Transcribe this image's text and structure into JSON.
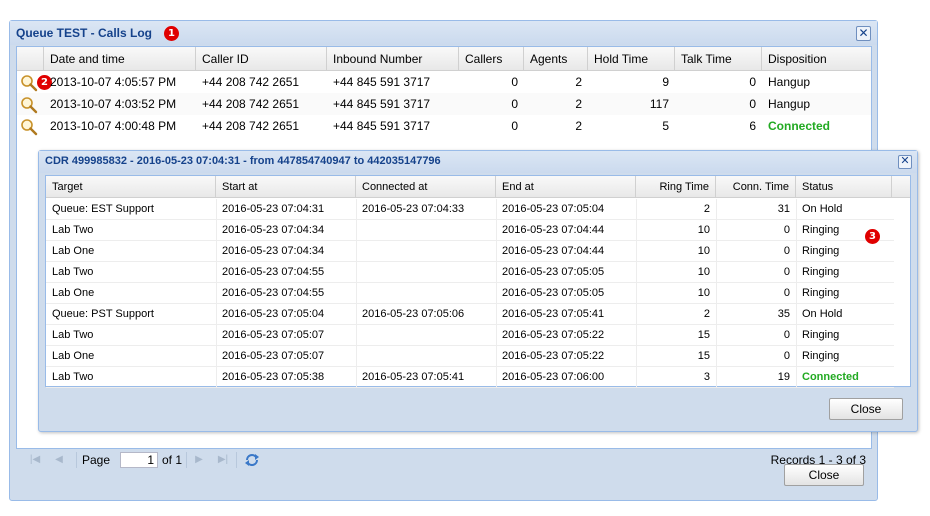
{
  "outer_window": {
    "title": "Queue TEST - Calls Log",
    "close_glyph": "✕",
    "badge": "1",
    "columns": [
      "Date and time",
      "Caller ID",
      "Inbound Number",
      "Callers",
      "Agents",
      "Hold Time",
      "Talk Time",
      "Disposition"
    ],
    "rows": [
      {
        "datetime": "2013-10-07 4:05:57 PM",
        "caller_id": "+44 208 742 2651",
        "inbound": "+44 845 591 3717",
        "callers": "0",
        "agents": "2",
        "hold": "9",
        "talk": "0",
        "disposition": "Hangup"
      },
      {
        "datetime": "2013-10-07 4:03:52 PM",
        "caller_id": "+44 208 742 2651",
        "inbound": "+44 845 591 3717",
        "callers": "0",
        "agents": "2",
        "hold": "117",
        "talk": "0",
        "disposition": "Hangup"
      },
      {
        "datetime": "2013-10-07 4:00:48 PM",
        "caller_id": "+44 208 742 2651",
        "inbound": "+44 845 591 3717",
        "callers": "0",
        "agents": "2",
        "hold": "5",
        "talk": "6",
        "disposition": "Connected"
      }
    ],
    "row_badge": "2",
    "pager": {
      "page_label": "Page",
      "page_value": "1",
      "of_label": "of 1",
      "records": "Records 1 - 3 of 3"
    },
    "close_button": "Close"
  },
  "inner_window": {
    "title": "CDR 499985832 - 2016-05-23 07:04:31 - from 447854740947 to 442035147796",
    "close_glyph": "✕",
    "badge": "3",
    "columns": [
      "Target",
      "Start at",
      "Connected at",
      "End at",
      "Ring Time",
      "Conn. Time",
      "Status"
    ],
    "rows": [
      {
        "target": "Queue: EST Support",
        "start": "2016-05-23 07:04:31",
        "connected": "2016-05-23 07:04:33",
        "end": "2016-05-23 07:05:04",
        "ring": "2",
        "conn": "31",
        "status": "On Hold"
      },
      {
        "target": "Lab Two",
        "start": "2016-05-23 07:04:34",
        "connected": "",
        "end": "2016-05-23 07:04:44",
        "ring": "10",
        "conn": "0",
        "status": "Ringing"
      },
      {
        "target": "Lab One",
        "start": "2016-05-23 07:04:34",
        "connected": "",
        "end": "2016-05-23 07:04:44",
        "ring": "10",
        "conn": "0",
        "status": "Ringing"
      },
      {
        "target": "Lab Two",
        "start": "2016-05-23 07:04:55",
        "connected": "",
        "end": "2016-05-23 07:05:05",
        "ring": "10",
        "conn": "0",
        "status": "Ringing"
      },
      {
        "target": "Lab One",
        "start": "2016-05-23 07:04:55",
        "connected": "",
        "end": "2016-05-23 07:05:05",
        "ring": "10",
        "conn": "0",
        "status": "Ringing"
      },
      {
        "target": "Queue: PST Support",
        "start": "2016-05-23 07:05:04",
        "connected": "2016-05-23 07:05:06",
        "end": "2016-05-23 07:05:41",
        "ring": "2",
        "conn": "35",
        "status": "On Hold"
      },
      {
        "target": "Lab Two",
        "start": "2016-05-23 07:05:07",
        "connected": "",
        "end": "2016-05-23 07:05:22",
        "ring": "15",
        "conn": "0",
        "status": "Ringing"
      },
      {
        "target": "Lab One",
        "start": "2016-05-23 07:05:07",
        "connected": "",
        "end": "2016-05-23 07:05:22",
        "ring": "15",
        "conn": "0",
        "status": "Ringing"
      },
      {
        "target": "Lab Two",
        "start": "2016-05-23 07:05:38",
        "connected": "2016-05-23 07:05:41",
        "end": "2016-05-23 07:06:00",
        "ring": "3",
        "conn": "19",
        "status": "Connected"
      }
    ],
    "close_button": "Close"
  },
  "colors": {
    "title": "#15428b",
    "connected": "#22aa22",
    "badge": "#e00000"
  },
  "icons": {
    "row_detail": "magnifier-icon",
    "first_page": "first-page-icon",
    "prev_page": "prev-page-icon",
    "next_page": "next-page-icon",
    "last_page": "last-page-icon",
    "refresh": "refresh-icon"
  }
}
